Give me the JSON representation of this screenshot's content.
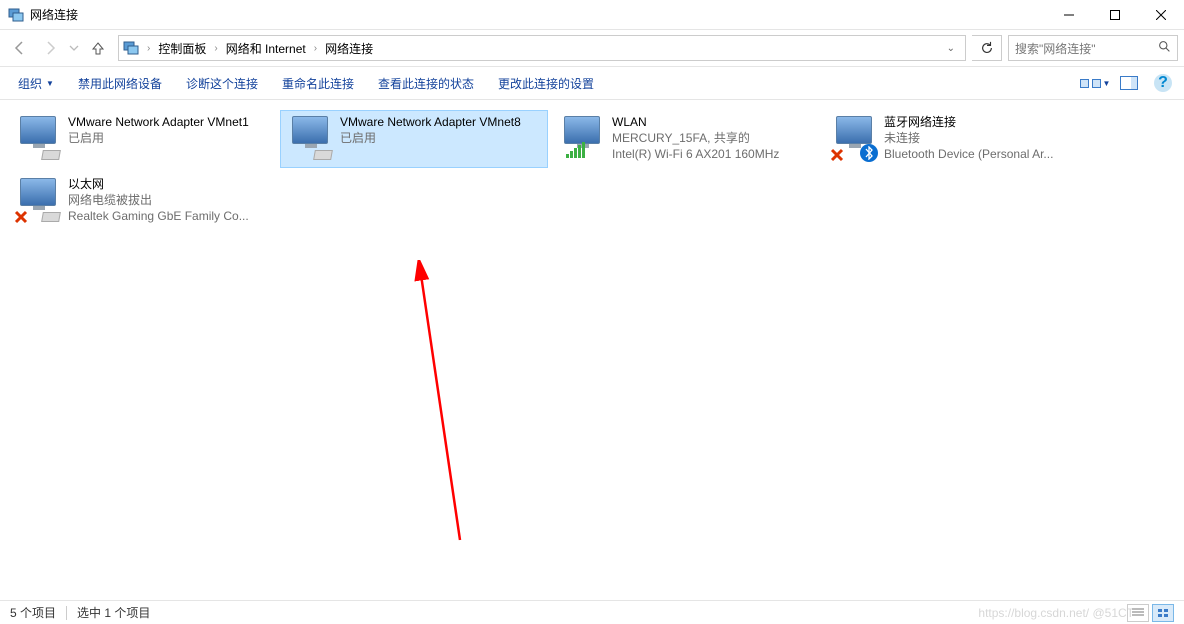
{
  "window": {
    "title": "网络连接",
    "minimize_tooltip": "Minimize",
    "maximize_tooltip": "Maximize",
    "close_tooltip": "Close"
  },
  "breadcrumbs": {
    "items": [
      "控制面板",
      "网络和 Internet",
      "网络连接"
    ]
  },
  "search": {
    "placeholder": "搜索\"网络连接\""
  },
  "commands": {
    "organize": "组织",
    "disable": "禁用此网络设备",
    "diagnose": "诊断这个连接",
    "rename": "重命名此连接",
    "view_status": "查看此连接的状态",
    "change_settings": "更改此连接的设置"
  },
  "adapters": [
    {
      "name": "VMware Network Adapter VMnet1",
      "status": "已启用",
      "device": "",
      "icon": "adapter",
      "selected": false
    },
    {
      "name": "VMware Network Adapter VMnet8",
      "status": "已启用",
      "device": "",
      "icon": "adapter",
      "selected": true
    },
    {
      "name": "WLAN",
      "status": "MERCURY_15FA, 共享的",
      "device": "Intel(R) Wi-Fi 6 AX201 160MHz",
      "icon": "wifi",
      "selected": false
    },
    {
      "name": "蓝牙网络连接",
      "status": "未连接",
      "device": "Bluetooth Device (Personal Ar...",
      "icon": "bluetooth-x",
      "selected": false
    },
    {
      "name": "以太网",
      "status": "网络电缆被拔出",
      "device": "Realtek Gaming GbE Family Co...",
      "icon": "ethernet-x",
      "selected": false
    }
  ],
  "statusbar": {
    "count_label": "5 个项目",
    "selection_label": "选中 1 个项目"
  },
  "watermark": "https://blog.csdn.net/  @51CT  "
}
